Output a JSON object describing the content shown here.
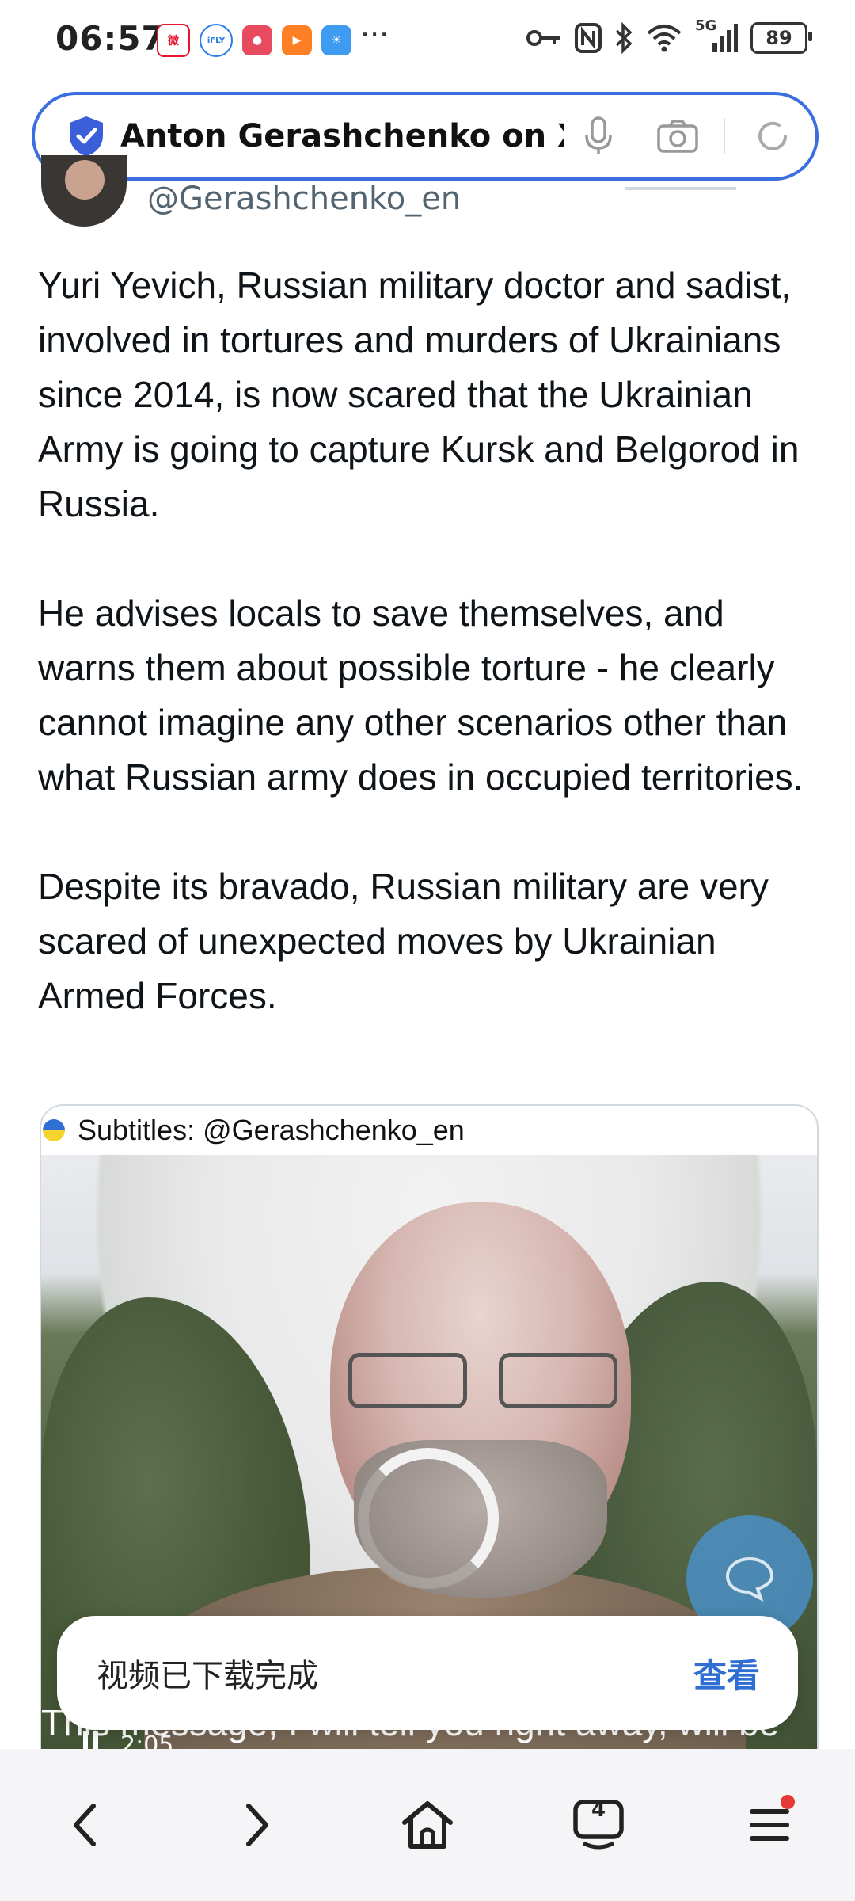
{
  "status_bar": {
    "time": "06:57",
    "app_icons": [
      "weibo-icon",
      "ifly-icon",
      "red-app-icon",
      "video-app-icon",
      "weather-icon"
    ],
    "more": "···",
    "battery": "89",
    "network": "5G"
  },
  "url_bar": {
    "title": "Anton Gerashchenko on X:"
  },
  "tweet": {
    "handle": "@Gerashchenko_en",
    "paragraphs": [
      "Yuri Yevich, Russian military doctor and sadist, involved in tortures and murders of Ukrainians since 2014, is now scared that the Ukrainian Army is going to capture Kursk and Belgorod in Russia.",
      "He advises locals to save themselves, and warns them about possible torture - he clearly cannot imagine any other scenarios other than what Russian army does in occupied territories.",
      "Despite its bravado, Russian military are very scared of unexpected moves by Ukrainian Armed Forces."
    ]
  },
  "video": {
    "subtitle_label": "Subtitles: @Gerashchenko_en",
    "caption": "This message, I will tell you right away, will be",
    "time": "2:05"
  },
  "toast": {
    "message": "视频已下载完成",
    "action": "查看"
  },
  "bottom_nav": {
    "tab_count": "4"
  },
  "colors": {
    "accent": "#2f6ed3",
    "url_border": "#3b6fe0",
    "handle_gray": "#536471"
  }
}
